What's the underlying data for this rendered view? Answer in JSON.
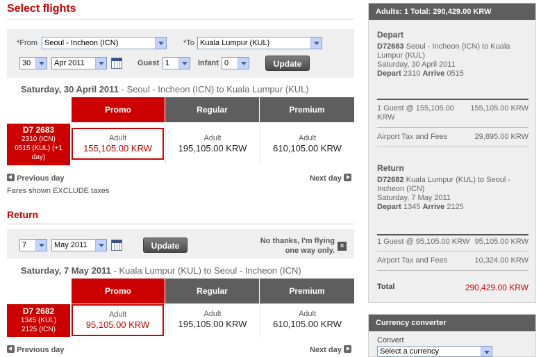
{
  "depart_section": {
    "title": "Select flights",
    "from_label": "*From",
    "from_value": "Seoul - Incheon (ICN)",
    "to_label": "*To",
    "to_value": "Kuala Lumpur (KUL)",
    "day": "30",
    "month": "Apr 2011",
    "guest_label": "Guest",
    "guest_value": "1",
    "infant_label": "Infant",
    "infant_value": "0",
    "update_label": "Update",
    "date_heading": "Saturday, 30 April 2011",
    "route_text": " - Seoul - Incheon (ICN)  to  Kuala Lumpur (KUL)",
    "flight": {
      "number": "D7  2683",
      "line1": "2310 (ICN)",
      "line2": "0515 (KUL)  (+1",
      "line3": "day)"
    },
    "fares": [
      {
        "tier": "Promo",
        "type": "Adult",
        "price": "155,105.00 KRW"
      },
      {
        "tier": "Regular",
        "type": "Adult",
        "price": "195,105.00 KRW"
      },
      {
        "tier": "Premium",
        "type": "Adult",
        "price": "610,105.00 KRW"
      }
    ],
    "prev_day": "Previous day",
    "next_day": "Next day",
    "fares_note": "Fares shown EXCLUDE taxes"
  },
  "return_section": {
    "title": "Return",
    "day": "7",
    "month": "May 2011",
    "update_label": "Update",
    "one_way_line1": "No thanks, I'm flying",
    "one_way_line2": "one way only.",
    "close_glyph": "×",
    "date_heading": "Saturday, 7 May 2011",
    "route_text": " - Kuala Lumpur (KUL)  to  Seoul - Incheon (ICN)",
    "flight": {
      "number": "D7  2682",
      "line1": "1345 (KUL)",
      "line2": "2125 (ICN)"
    },
    "fares": [
      {
        "tier": "Promo",
        "type": "Adult",
        "price": "95,105.00 KRW"
      },
      {
        "tier": "Regular",
        "type": "Adult",
        "price": "195,105.00 KRW"
      },
      {
        "tier": "Premium",
        "type": "Adult",
        "price": "610,105.00 KRW"
      }
    ],
    "prev_day": "Previous day",
    "next_day": "Next day"
  },
  "summary": {
    "header": "Adults: 1  Total: 290,429.00 KRW",
    "depart_title": "Depart",
    "depart_flight": "D72683",
    "depart_route": " Seoul - Incheon (ICN) to Kuala Lumpur (KUL)",
    "depart_date": "Saturday, 30 April 2011",
    "depart_label": "Depart",
    "depart_time": "2310",
    "arrive_label": "Arrive",
    "arrive_time": "0515",
    "depart_guest": "1 Guest @ 155,105.00 KRW",
    "depart_guest_amount": "155,105.00 KRW",
    "depart_tax_label": "Airport Tax and Fees",
    "depart_tax_amount": "29,895.00 KRW",
    "return_title": "Return",
    "return_flight": "D72682",
    "return_route": " Kuala Lumpur (KUL) to Seoul - Incheon (ICN)",
    "return_date": "Saturday, 7 May 2011",
    "return_depart_time": "1345",
    "return_arrive_time": "2125",
    "return_guest": "1 Guest @ 95,105.00 KRW",
    "return_guest_amount": "95,105.00 KRW",
    "return_tax_label": "Airport Tax and Fees",
    "return_tax_amount": "10,324.00 KRW",
    "total_label": "Total",
    "total_amount": "290,429.00 KRW"
  },
  "converter": {
    "header": "Currency converter",
    "convert_label": "Convert",
    "select_placeholder": "Select a currency"
  },
  "colors": {
    "brand_red": "#cc0000",
    "header_grey": "#5e5e5e",
    "panel_bg": "#efefef"
  }
}
